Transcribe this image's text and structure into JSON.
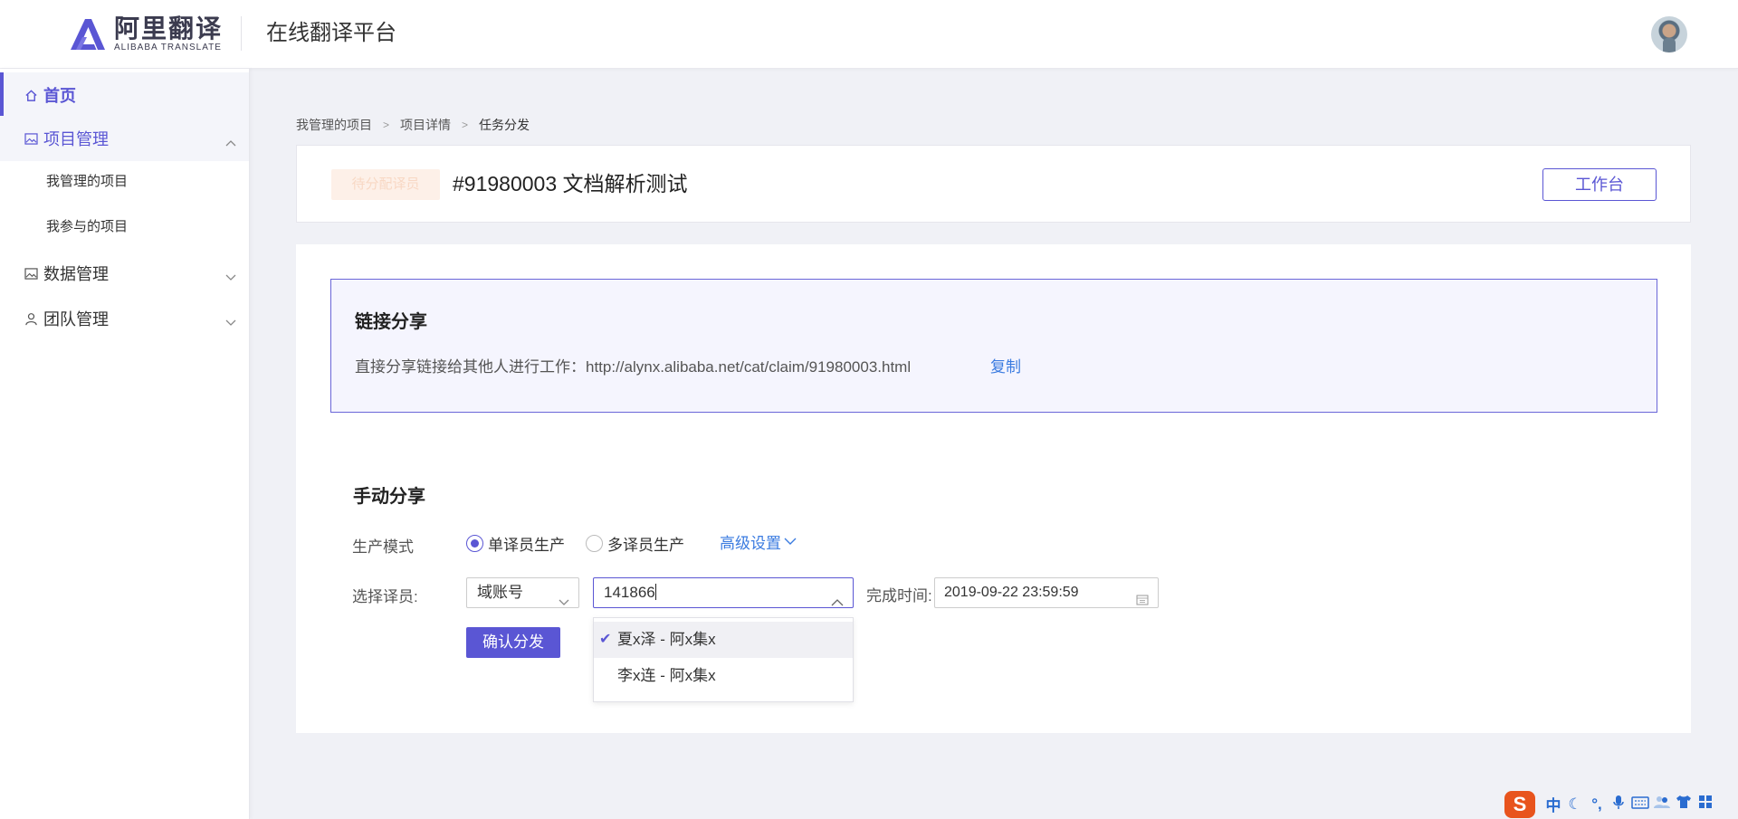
{
  "header": {
    "logo_cn": "阿里翻译",
    "logo_en": "ALIBABA TRANSLATE",
    "platform_title": "在线翻译平台"
  },
  "sidebar": {
    "items": [
      {
        "label": "首页",
        "icon": "home-icon",
        "active": true
      },
      {
        "label": "项目管理",
        "icon": "image-icon",
        "expanded": true,
        "children": [
          "我管理的项目",
          "我参与的项目"
        ]
      },
      {
        "label": "数据管理",
        "icon": "image-icon",
        "expanded": false
      },
      {
        "label": "团队管理",
        "icon": "user-icon",
        "expanded": false
      }
    ]
  },
  "breadcrumb": [
    "我管理的项目",
    "项目详情",
    "任务分发"
  ],
  "project": {
    "status": "待分配译员",
    "title": "#91980003 文档解析测试",
    "workbench_label": "工作台"
  },
  "link_share": {
    "title": "链接分享",
    "text": "直接分享链接给其他人进行工作：http://alynx.alibaba.net/cat/claim/91980003.html",
    "copy_label": "复制"
  },
  "manual_share": {
    "title": "手动分享",
    "mode_label": "生产模式",
    "mode_options": [
      "单译员生产",
      "多译员生产"
    ],
    "mode_selected": "单译员生产",
    "advanced_label": "高级设置",
    "translator_label": "选择译员:",
    "account_type": "域账号",
    "search_value": "141866",
    "deadline_label": "完成时间:",
    "deadline_value": "2019-09-22 23:59:59",
    "confirm_label": "确认分发",
    "dropdown_options": [
      "夏x泽 - 阿x集x",
      "李x连 - 阿x集x"
    ],
    "dropdown_selected": "夏x泽 - 阿x集x"
  },
  "ime": {
    "logo": "S",
    "lang": "中"
  },
  "colors": {
    "accent": "#5a56d4",
    "link": "#3a7be0",
    "background": "#f0f1f6"
  }
}
